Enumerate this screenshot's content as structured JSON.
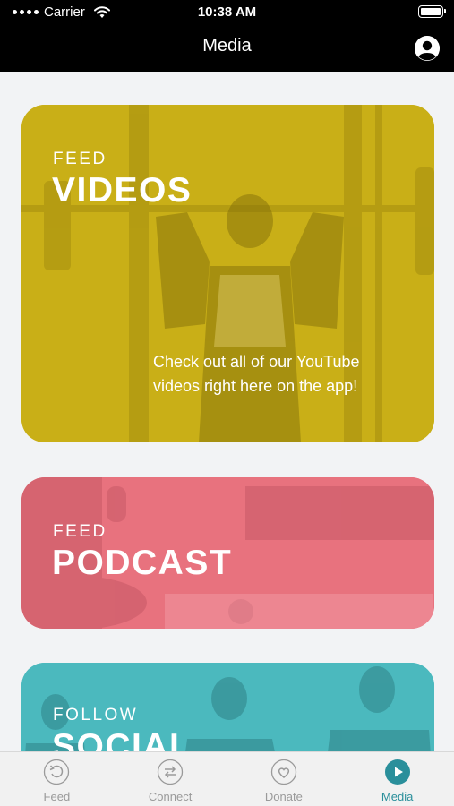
{
  "status_bar": {
    "carrier": "Carrier",
    "time": "10:38 AM"
  },
  "nav": {
    "title": "Media",
    "profile_icon": "person-circle-icon"
  },
  "cards": [
    {
      "kicker": "FEED",
      "heading": "VIDEOS",
      "description": "Check out all of our YouTube videos right here on the app!",
      "color": "#c9af17"
    },
    {
      "kicker": "FEED",
      "heading": "PODCAST",
      "color": "#e8727e"
    },
    {
      "kicker": "FOLLOW",
      "heading": "SOCIAL",
      "color": "#4bb9be"
    }
  ],
  "tabs": [
    {
      "label": "Feed",
      "icon": "refresh-icon",
      "active": false
    },
    {
      "label": "Connect",
      "icon": "arrows-exchange-icon",
      "active": false
    },
    {
      "label": "Donate",
      "icon": "heart-icon",
      "active": false
    },
    {
      "label": "Media",
      "icon": "play-icon",
      "active": true
    }
  ],
  "colors": {
    "accent": "#2a8f9b",
    "inactive": "#9a9a9a"
  }
}
